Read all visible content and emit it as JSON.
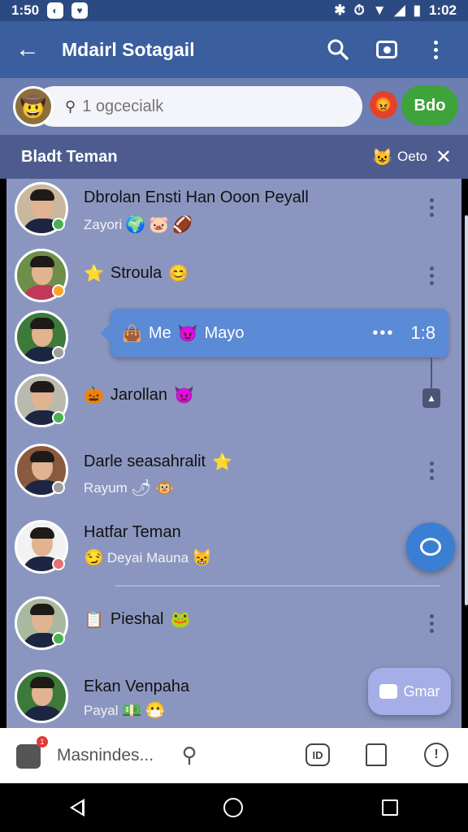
{
  "status_bar": {
    "time": "1:50",
    "time_right": "1:02"
  },
  "app_bar": {
    "title": "Mdairl Sotagail"
  },
  "search": {
    "placeholder": "1 ogcecialk",
    "button_label": "Bdo"
  },
  "section": {
    "title": "Bladt Teman",
    "tag": "Oeto"
  },
  "contacts": [
    {
      "name": "Dbrolan Ensti Han Ooon Peyall",
      "subtitle": "Zayori",
      "presence_color": "#4caf50"
    },
    {
      "name": "Stroula",
      "subtitle": "",
      "presence_color": "#f5a623"
    },
    {
      "name": "",
      "subtitle": "",
      "presence_color": "#9e9e9e"
    },
    {
      "name": "Jarollan",
      "subtitle": "",
      "presence_color": "#4caf50"
    },
    {
      "name": "Darle seasahralit",
      "subtitle": "Rayum",
      "presence_color": "#9e9e9e"
    },
    {
      "name": "Hatfar Teman",
      "subtitle": "Deyai Mauna",
      "presence_color": "#e57373"
    },
    {
      "name": "Pieshal",
      "subtitle": "",
      "presence_color": "#4caf50"
    },
    {
      "name": "Ekan Venpaha",
      "subtitle": "Payal",
      "presence_color": ""
    }
  ],
  "bubble": {
    "text_a": "Me",
    "text_b": "Mayo",
    "dots": "•••",
    "time": "1:8"
  },
  "fab_text_label": "Gmar",
  "bottom_bar": {
    "label": "Masnindes...",
    "badge": "1"
  },
  "colors": {
    "app_bar": "#3a5e9e",
    "list_bg": "#8b96c0",
    "accent_green": "#3ea33b",
    "fab_blue": "#3b7fd4"
  },
  "icons": [
    "back-arrow-icon",
    "search-icon",
    "camera-icon",
    "more-vert-icon",
    "close-icon",
    "chat-icon",
    "share-icon",
    "id-card-icon",
    "home-icon",
    "alert-icon"
  ]
}
